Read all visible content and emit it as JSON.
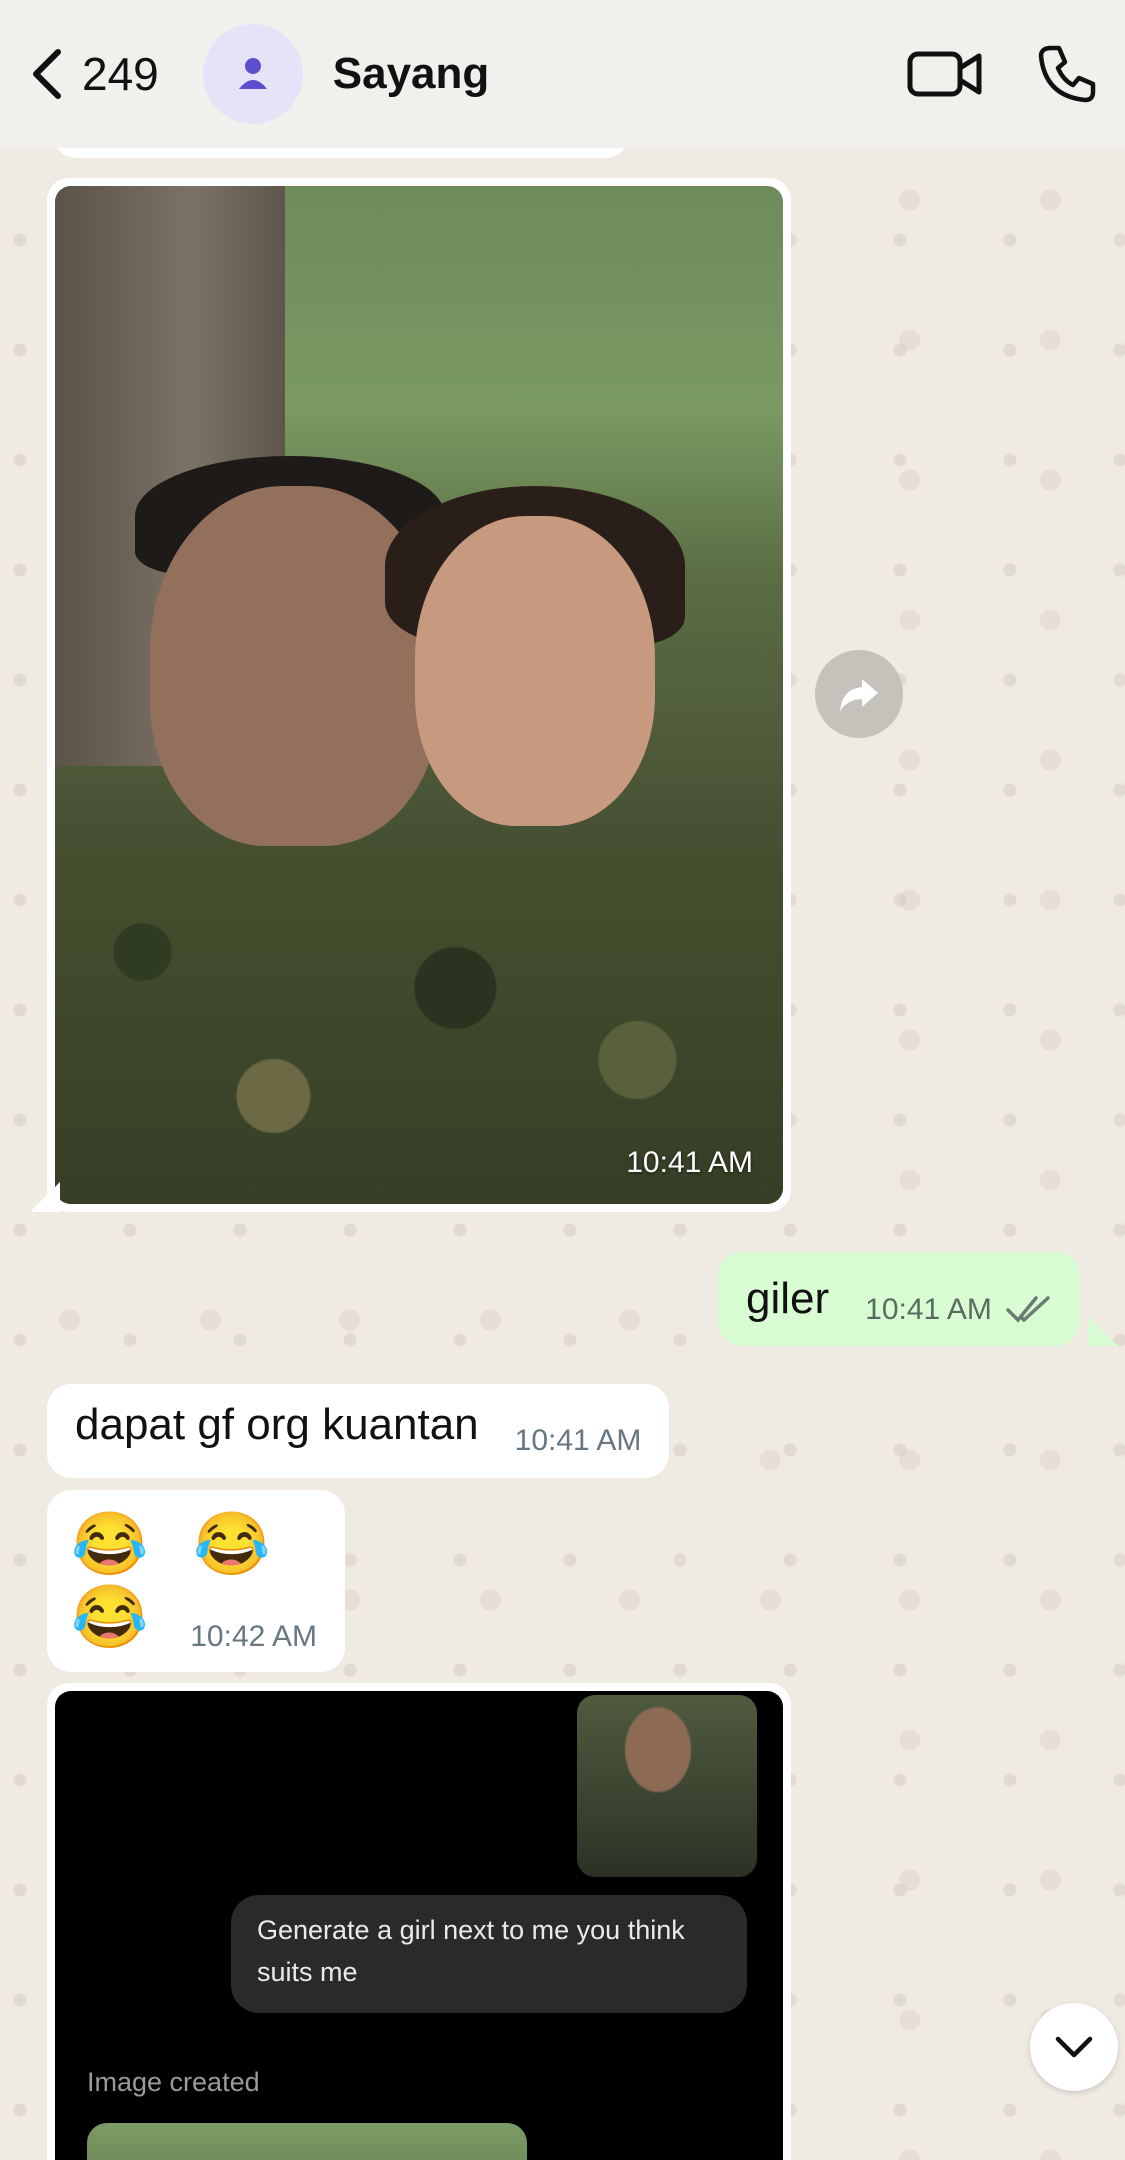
{
  "header": {
    "back_count": "249",
    "contact_name": "Sayang",
    "icons": [
      "chevron-left-icon",
      "person-icon",
      "video-camera-icon",
      "phone-icon"
    ]
  },
  "messages": [
    {
      "type": "image",
      "direction": "incoming",
      "time": "10:41 AM"
    },
    {
      "type": "text",
      "direction": "outgoing",
      "text": "giler",
      "time": "10:41 AM",
      "status": "read"
    },
    {
      "type": "text",
      "direction": "incoming",
      "text": "dapat gf org kuantan",
      "time": "10:41 AM"
    },
    {
      "type": "text",
      "direction": "incoming",
      "text": "😂 😂 😂",
      "time": "10:42 AM"
    },
    {
      "type": "image",
      "direction": "incoming",
      "screenshot": {
        "prompt": "Generate a girl next to me you think suits me",
        "label": "Image created"
      }
    }
  ],
  "colors": {
    "outgoing_bubble": "#d9fdd3",
    "incoming_bubble": "#ffffff",
    "wallpaper": "#efeae2",
    "avatar_bg": "#e6e2f7",
    "avatar_icon": "#5b4fcf",
    "read_ticks": "#6b7d72"
  }
}
